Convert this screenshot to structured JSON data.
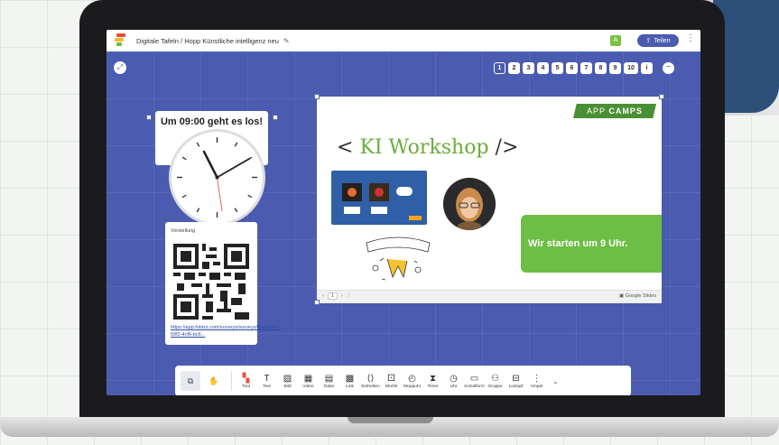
{
  "breadcrumb": {
    "app": "Digitale Tafeln",
    "separator": "/",
    "board": "Hopp Künstliche intelligenz neu"
  },
  "header": {
    "avatar_letter": "A",
    "share_label": "Teilen"
  },
  "pages": [
    "1",
    "2",
    "3",
    "4",
    "5",
    "6",
    "7",
    "8",
    "9",
    "10"
  ],
  "info_label": "i",
  "clock_card": {
    "title": "Um 09:00 geht es los!"
  },
  "survey_card": {
    "title": "Vorstellung",
    "link": "https://app.fobizz.com/surveys/surveys/feaa7ae3-59f2-4cf6-bc6..."
  },
  "slide": {
    "brand_a": "APP",
    "brand_b": "CAMPS",
    "title_open": "< ",
    "title_main": "KI Workshop",
    "title_close": " />",
    "green_text": "Wir starten um 9 Uhr.",
    "page_indicator": "1",
    "provider": "Google Slides"
  },
  "toolbar": {
    "tools": [
      {
        "label": "Tool",
        "icon": "tool-icon"
      },
      {
        "label": "Text",
        "icon": "text-icon"
      },
      {
        "label": "Bild",
        "icon": "image-icon"
      },
      {
        "label": "Video",
        "icon": "video-icon"
      },
      {
        "label": "Datei",
        "icon": "file-icon"
      },
      {
        "label": "Link",
        "icon": "qr-link-icon"
      },
      {
        "label": "Einbetten",
        "icon": "embed-icon"
      },
      {
        "label": "Würfel",
        "icon": "dice-icon"
      },
      {
        "label": "Stoppuhr",
        "icon": "stopwatch-icon"
      },
      {
        "label": "Timer",
        "icon": "hourglass-icon"
      },
      {
        "label": "Uhr",
        "icon": "clock-icon"
      },
      {
        "label": "Sozialform",
        "icon": "social-form-icon"
      },
      {
        "label": "Gruppe",
        "icon": "group-icon"
      },
      {
        "label": "Lostopf",
        "icon": "lottery-icon"
      },
      {
        "label": "Ampel",
        "icon": "traffic-light-icon"
      }
    ]
  },
  "colors": {
    "board": "#4a5bb0",
    "accent_green": "#6cbe45",
    "brand_green": "#4a8f33"
  }
}
